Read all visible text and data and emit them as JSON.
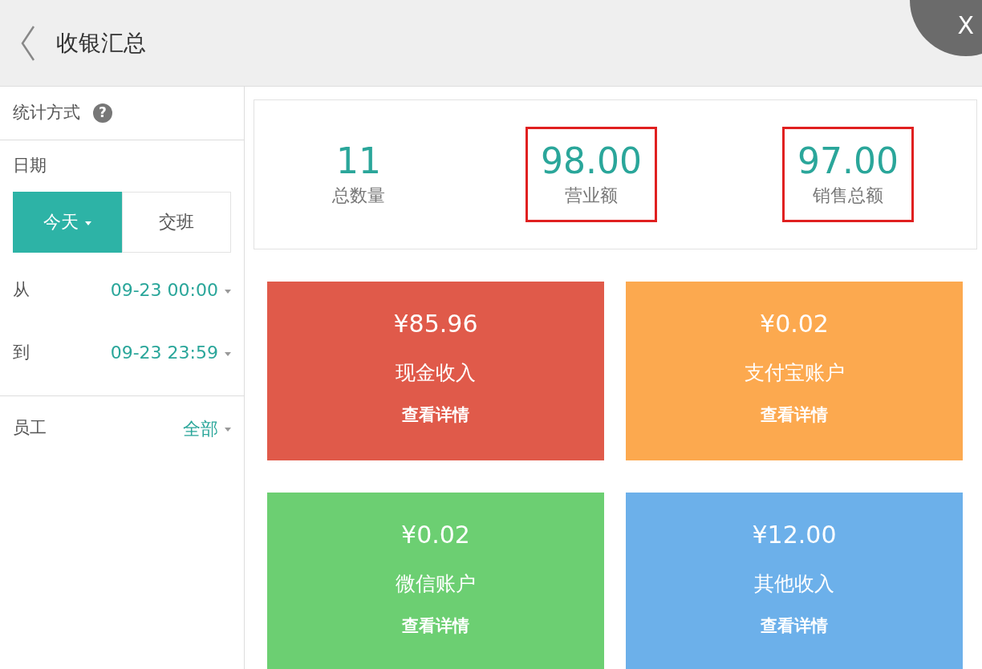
{
  "header": {
    "title": "收银汇总",
    "close": "X"
  },
  "sidebar": {
    "method_label": "统计方式",
    "help": "?",
    "date_label": "日期",
    "segments": [
      {
        "label": "今天",
        "selected": true,
        "dropdown": true
      },
      {
        "label": "交班",
        "selected": false,
        "dropdown": false
      }
    ],
    "range": [
      {
        "label": "从",
        "value": "09-23 00:00"
      },
      {
        "label": "到",
        "value": "09-23 23:59"
      }
    ],
    "staff": {
      "label": "员工",
      "value": "全部"
    }
  },
  "summary": [
    {
      "value": "11",
      "label": "总数量",
      "highlighted": false
    },
    {
      "value": "98.00",
      "label": "营业额",
      "highlighted": true
    },
    {
      "value": "97.00",
      "label": "销售总额",
      "highlighted": true
    }
  ],
  "tiles": [
    {
      "amount": "¥85.96",
      "label": "现金收入",
      "link": "查看详情",
      "color": "#e05a4a"
    },
    {
      "amount": "¥0.02",
      "label": "支付宝账户",
      "link": "查看详情",
      "color": "#fca94f"
    },
    {
      "amount": "¥0.02",
      "label": "微信账户",
      "link": "查看详情",
      "color": "#6ccf72"
    },
    {
      "amount": "¥12.00",
      "label": "其他收入",
      "link": "查看详情",
      "color": "#6cb0ea"
    }
  ]
}
